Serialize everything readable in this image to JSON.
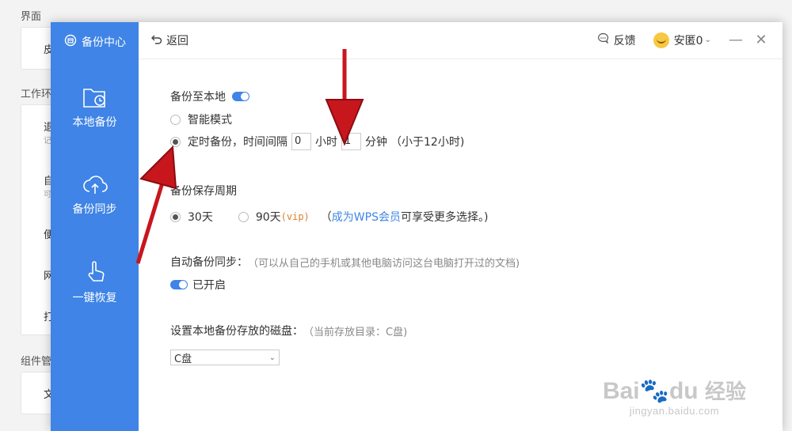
{
  "background": {
    "section_interface": "界面",
    "item_interface": "皮",
    "section_work": "工作环",
    "items": [
      {
        "label": "退",
        "sub": "记"
      },
      {
        "label": "自",
        "sub": "可"
      },
      {
        "label": "便",
        "sub": ""
      },
      {
        "label": "网",
        "sub": ""
      },
      {
        "label": "打",
        "sub": ""
      }
    ],
    "section_components": "组件管",
    "item_component": "文"
  },
  "sidebar": {
    "header": "备份中心",
    "items": [
      {
        "label": "本地备份",
        "icon": "folder-clock-icon"
      },
      {
        "label": "备份同步",
        "icon": "cloud-upload-icon"
      },
      {
        "label": "一键恢复",
        "icon": "hand-pointer-icon"
      }
    ]
  },
  "topbar": {
    "back": "返回",
    "feedback": "反馈",
    "username": "安匿0"
  },
  "backup_local": {
    "title": "备份至本地",
    "enabled": true,
    "mode_smart": "智能模式",
    "mode_timed": "定时备份，时间间隔",
    "hours_value": "0",
    "hours_unit": "小时",
    "minutes_value": "1",
    "minutes_unit": "分钟",
    "hint": "（小于12小时)"
  },
  "retention": {
    "title": "备份保存周期",
    "opt_30": "30天",
    "opt_90": "90天",
    "vip_tag": "(vip)",
    "note_open": "（",
    "member_link": "成为WPS会员",
    "note_rest": " 可享受更多选择。)"
  },
  "sync": {
    "title": "自动备份同步：",
    "desc": "（可以从自己的手机或其他电脑访问这台电脑打开过的文档)",
    "status": "已开启"
  },
  "disk": {
    "title": "设置本地备份存放的磁盘：",
    "current": "（当前存放目录：C盘)",
    "selected": "C盘"
  },
  "watermark": {
    "brand": "Bai",
    "brand2": "du",
    "cn": "经验",
    "url": "jingyan.baidu.com"
  },
  "colors": {
    "accent": "#3f84e6",
    "arrow": "#c8161d"
  }
}
